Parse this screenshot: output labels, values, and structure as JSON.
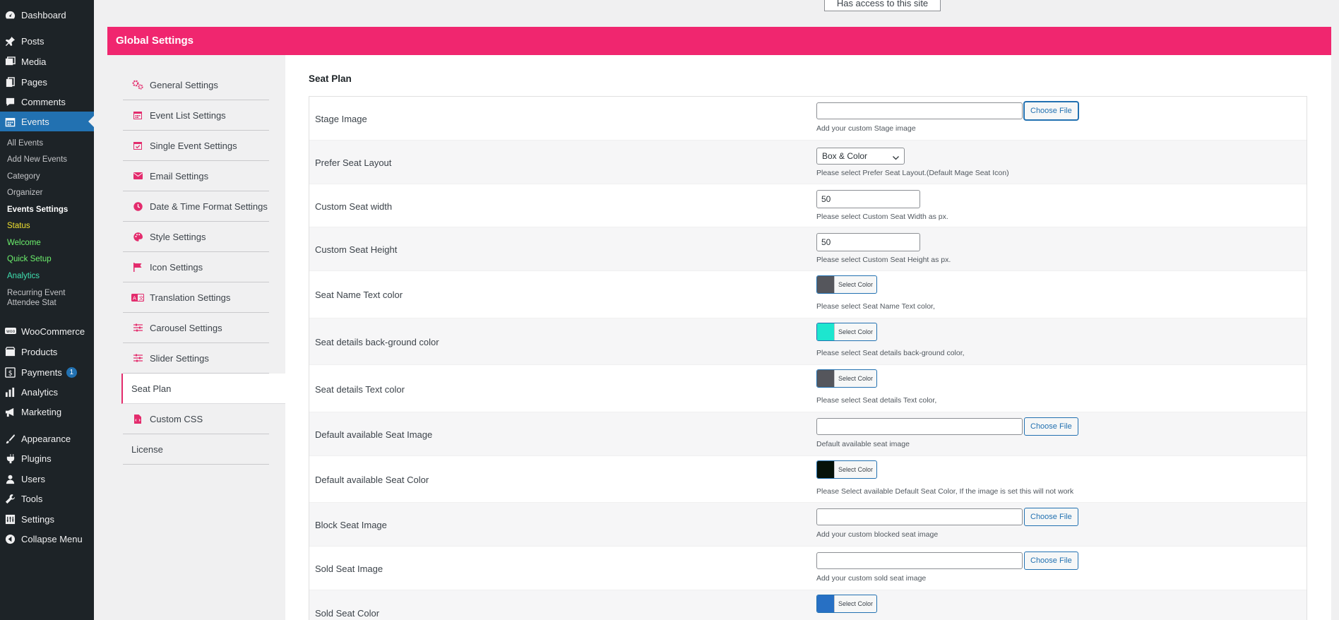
{
  "admin_menu": {
    "items": [
      {
        "label": "Dashboard",
        "icon": "dashboard-icon"
      },
      {
        "label": "Posts",
        "icon": "pin-icon"
      },
      {
        "label": "Media",
        "icon": "media-icon"
      },
      {
        "label": "Pages",
        "icon": "pages-icon"
      },
      {
        "label": "Comments",
        "icon": "comments-icon"
      },
      {
        "label": "Events",
        "icon": "calendar-icon"
      }
    ],
    "events_sub": [
      "All Events",
      "Add New Events",
      "Category",
      "Organizer",
      "Events Settings",
      "Status",
      "Welcome",
      "Quick Setup",
      "Analytics",
      "Recurring Event Attendee Stat"
    ],
    "items2": [
      {
        "label": "WooCommerce",
        "icon": "woocommerce-icon"
      },
      {
        "label": "Products",
        "icon": "products-icon"
      },
      {
        "label": "Payments",
        "icon": "payments-icon",
        "badge": "1"
      },
      {
        "label": "Analytics",
        "icon": "analytics-icon"
      },
      {
        "label": "Marketing",
        "icon": "marketing-icon"
      },
      {
        "label": "Appearance",
        "icon": "brush-icon"
      },
      {
        "label": "Plugins",
        "icon": "plugin-icon"
      },
      {
        "label": "Users",
        "icon": "users-icon"
      },
      {
        "label": "Tools",
        "icon": "tools-icon"
      },
      {
        "label": "Settings",
        "icon": "settings-icon"
      },
      {
        "label": "Collapse Menu",
        "icon": "collapse-icon"
      }
    ]
  },
  "access_tag": "Has access to this site",
  "header": {
    "title": "Global Settings"
  },
  "nav": {
    "items": [
      {
        "label": "General Settings",
        "icon": "gears-icon"
      },
      {
        "label": "Event List Settings",
        "icon": "calendar-icon"
      },
      {
        "label": "Single Event Settings",
        "icon": "calendar-check-icon"
      },
      {
        "label": "Email Settings",
        "icon": "envelope-icon"
      },
      {
        "label": "Date & Time Format Settings",
        "icon": "clock-icon"
      },
      {
        "label": "Style Settings",
        "icon": "palette-icon"
      },
      {
        "label": "Icon Settings",
        "icon": "flag-icon"
      },
      {
        "label": "Translation Settings",
        "icon": "language-icon"
      },
      {
        "label": "Carousel Settings",
        "icon": "sliders-icon"
      },
      {
        "label": "Slider Settings",
        "icon": "sliders-icon"
      },
      {
        "label": "Seat Plan",
        "icon": ""
      },
      {
        "label": "Custom CSS",
        "icon": "file-code-icon"
      },
      {
        "label": "License",
        "icon": ""
      }
    ],
    "selected": "Seat Plan"
  },
  "main": {
    "section_title": "Seat Plan",
    "choose_file_label": "Choose File",
    "select_color_label": "Select Color",
    "rows": [
      {
        "label": "Stage Image",
        "type": "file",
        "desc": "Add your custom Stage image"
      },
      {
        "label": "Prefer Seat Layout",
        "type": "select",
        "value": "Box & Color",
        "desc": "Please select Prefer Seat Layout.(Default Mage Seat Icon)"
      },
      {
        "label": "Custom Seat width",
        "type": "number",
        "value": "50",
        "desc": "Please select Custom Seat Width as px."
      },
      {
        "label": "Custom Seat Height",
        "type": "number",
        "value": "50",
        "desc": "Please select Custom Seat Height as px."
      },
      {
        "label": "Seat Name Text color",
        "type": "color",
        "color": "#55565c",
        "desc": "Please select Seat Name Text color,"
      },
      {
        "label": "Seat details back-ground color",
        "type": "color",
        "color": "#1de6cf",
        "desc": "Please select Seat details back-ground color,"
      },
      {
        "label": "Seat details Text color",
        "type": "color",
        "color": "#55565c",
        "desc": "Please select Seat details Text color,"
      },
      {
        "label": "Default available Seat Image",
        "type": "file",
        "desc": "Default available seat image"
      },
      {
        "label": "Default available Seat Color",
        "type": "color",
        "color": "#061209",
        "desc": "Please Select available Default Seat Color, If the image is set this will not work"
      },
      {
        "label": "Block Seat Image",
        "type": "file",
        "desc": "Add your custom blocked seat image"
      },
      {
        "label": "Sold Seat Image",
        "type": "file",
        "desc": "Add your custom sold seat image"
      },
      {
        "label": "Sold Seat Color",
        "type": "color",
        "color": "#2770c4",
        "desc": ""
      }
    ]
  }
}
